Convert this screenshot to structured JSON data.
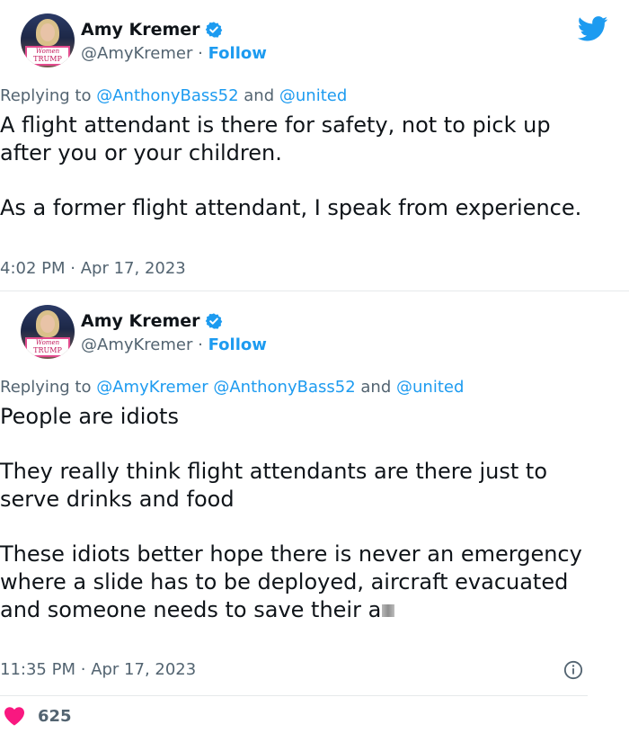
{
  "tweets": [
    {
      "author": {
        "name": "Amy Kremer",
        "handle": "@AmyKremer",
        "follow_label": "Follow",
        "avatar_sign_line1": "Women",
        "avatar_sign_line2": "TRUMP"
      },
      "reply_prefix": "Replying to",
      "reply_mentions": [
        "@AnthonyBass52",
        "@united"
      ],
      "reply_and": "and",
      "body": [
        "A flight attendant is there for safety, not to pick up after you or your children.",
        "As a former flight attendant, I speak from experience."
      ],
      "time": "4:02 PM",
      "date": "Apr 17, 2023"
    },
    {
      "author": {
        "name": "Amy Kremer",
        "handle": "@AmyKremer",
        "follow_label": "Follow",
        "avatar_sign_line1": "Women",
        "avatar_sign_line2": "TRUMP"
      },
      "reply_prefix": "Replying to",
      "reply_mentions": [
        "@AmyKremer",
        "@AnthonyBass52",
        "@united"
      ],
      "reply_and": "and",
      "body": [
        "People are idiots",
        "They really think flight attendants are there just to serve drinks and food",
        "These idiots better hope there is never an emergency where a slide has to be deployed, aircraft evacuated and someone needs to save their a"
      ],
      "time": "11:35 PM",
      "date": "Apr 17, 2023",
      "like_count": "625"
    }
  ],
  "separator": "·",
  "icons": {
    "verified": "verified-badge-icon",
    "bird": "twitter-bird-icon",
    "info": "info-icon",
    "heart": "heart-icon"
  },
  "colors": {
    "accent": "#1d9bf0",
    "secondary_text": "#536471",
    "heart": "#f91880"
  }
}
